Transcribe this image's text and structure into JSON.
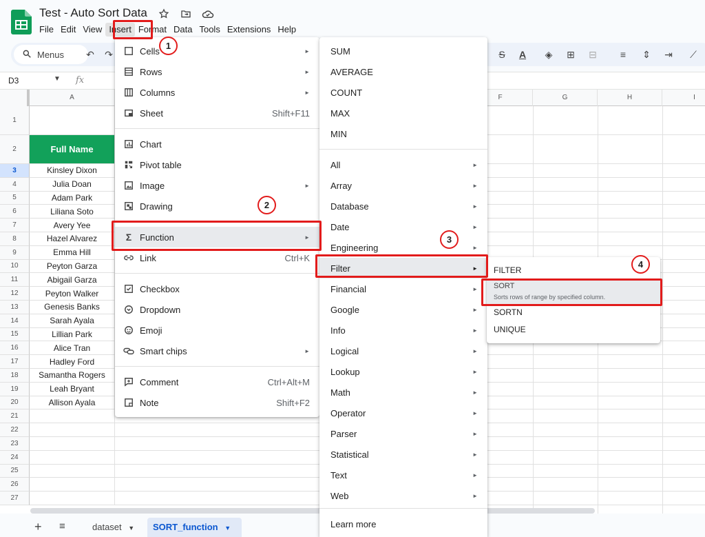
{
  "document": {
    "title": "Test - Auto Sort Data",
    "menus": [
      "File",
      "Edit",
      "View",
      "Insert",
      "Format",
      "Data",
      "Tools",
      "Extensions",
      "Help"
    ]
  },
  "toolbar": {
    "search_label": "Menus"
  },
  "formula_bar": {
    "cell_ref": "D3",
    "fx_symbol": "fx"
  },
  "grid": {
    "col_headers": [
      "A",
      "F",
      "G",
      "H",
      "I"
    ],
    "header_cell": "Full Name",
    "row_numbers": [
      "1",
      "2",
      "3",
      "4",
      "5",
      "6",
      "7",
      "8",
      "9",
      "10",
      "11",
      "12",
      "13",
      "14",
      "15",
      "16",
      "17",
      "18",
      "19",
      "20",
      "21",
      "22",
      "23",
      "24",
      "25",
      "26",
      "27"
    ],
    "names": [
      "Kinsley Dixon",
      "Julia Doan",
      "Adam Park",
      "Liliana Soto",
      "Avery Yee",
      "Hazel Alvarez",
      "Emma Hill",
      "Peyton Garza",
      "Abigail Garza",
      "Peyton Walker",
      "Genesis Banks",
      "Sarah Ayala",
      "Lillian Park",
      "Alice Tran",
      "Hadley Ford",
      "Samantha Rogers",
      "Leah Bryant",
      "Allison Ayala"
    ]
  },
  "sheet_tabs": {
    "tabs": [
      "dataset",
      "SORT_function"
    ],
    "active": "SORT_function"
  },
  "insert_menu": {
    "items": [
      {
        "label": "Cells",
        "icon": "cells-icon",
        "submenu": true
      },
      {
        "label": "Rows",
        "icon": "rows-icon",
        "submenu": true
      },
      {
        "label": "Columns",
        "icon": "columns-icon",
        "submenu": true
      },
      {
        "label": "Sheet",
        "icon": "sheet-icon",
        "shortcut": "Shift+F11"
      },
      {
        "label": "Chart",
        "icon": "chart-icon"
      },
      {
        "label": "Pivot table",
        "icon": "pivot-table-icon"
      },
      {
        "label": "Image",
        "icon": "image-icon",
        "submenu": true
      },
      {
        "label": "Drawing",
        "icon": "drawing-icon"
      },
      {
        "label": "Function",
        "icon": "sigma-icon",
        "submenu": true
      },
      {
        "label": "Link",
        "icon": "link-icon",
        "shortcut": "Ctrl+K"
      },
      {
        "label": "Checkbox",
        "icon": "checkbox-icon"
      },
      {
        "label": "Dropdown",
        "icon": "dropdown-icon"
      },
      {
        "label": "Emoji",
        "icon": "emoji-icon"
      },
      {
        "label": "Smart chips",
        "icon": "smart-chips-icon",
        "submenu": true
      },
      {
        "label": "Comment",
        "icon": "comment-icon",
        "shortcut": "Ctrl+Alt+M"
      },
      {
        "label": "Note",
        "icon": "note-icon",
        "shortcut": "Shift+F2"
      }
    ]
  },
  "function_menu": {
    "items": [
      "SUM",
      "AVERAGE",
      "COUNT",
      "MAX",
      "MIN",
      "All",
      "Array",
      "Database",
      "Date",
      "Engineering",
      "Filter",
      "Financial",
      "Google",
      "Info",
      "Logical",
      "Lookup",
      "Math",
      "Operator",
      "Parser",
      "Statistical",
      "Text",
      "Web",
      "Learn more"
    ]
  },
  "filter_menu": {
    "items": [
      {
        "label": "FILTER",
        "desc": ""
      },
      {
        "label": "SORT",
        "desc": "Sorts rows of range by specified column."
      },
      {
        "label": "SORTN",
        "desc": ""
      },
      {
        "label": "UNIQUE",
        "desc": ""
      }
    ]
  },
  "steps": [
    "1",
    "2",
    "3",
    "4"
  ],
  "colors": {
    "header_green": "#12a15a",
    "annotation_red": "#e21b1b",
    "accent_blue": "#0b57d0"
  }
}
